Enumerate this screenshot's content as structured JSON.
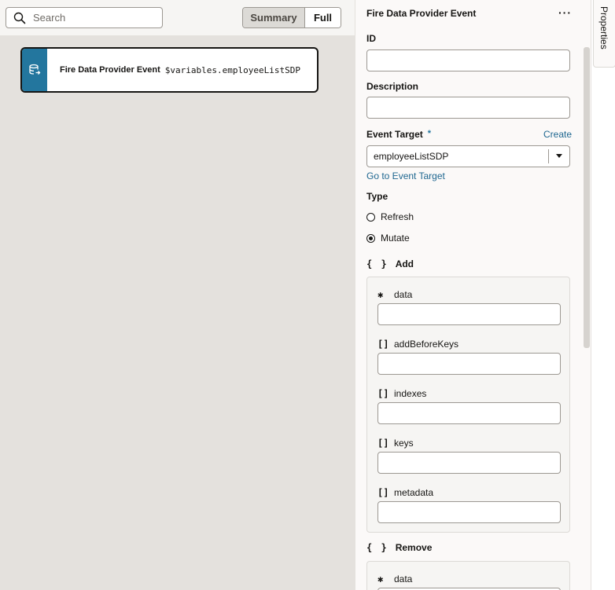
{
  "canvas": {
    "search": {
      "placeholder": "Search"
    },
    "view_toggle": {
      "summary_label": "Summary",
      "full_label": "Full",
      "selected": "Summary"
    },
    "action": {
      "title": "Fire Data Provider Event",
      "expression": "$variables.employeeListSDP",
      "icon": "database-event-icon"
    }
  },
  "panel": {
    "title": "Fire Data Provider Event",
    "more_label": "···",
    "id": {
      "label": "ID",
      "value": ""
    },
    "description": {
      "label": "Description",
      "value": ""
    },
    "event_target": {
      "label": "Event Target",
      "required_marker": "*",
      "create_link": "Create",
      "value": "employeeListSDP",
      "goto_link": "Go to Event Target"
    },
    "type": {
      "label": "Type",
      "options": [
        "Refresh",
        "Mutate"
      ],
      "selected": "Mutate"
    },
    "add": {
      "label": "Add",
      "braces": "{ }",
      "props": [
        {
          "glyph": "✱",
          "label": "data",
          "value": ""
        },
        {
          "glyph": "[]",
          "label": "addBeforeKeys",
          "value": ""
        },
        {
          "glyph": "[]",
          "label": "indexes",
          "value": ""
        },
        {
          "glyph": "[]",
          "label": "keys",
          "value": ""
        },
        {
          "glyph": "[]",
          "label": "metadata",
          "value": ""
        }
      ]
    },
    "remove": {
      "label": "Remove",
      "braces": "{ }",
      "props": [
        {
          "glyph": "✱",
          "label": "data",
          "value": ""
        }
      ]
    }
  },
  "sidetab": {
    "label": "Properties"
  },
  "colors": {
    "accent": "#23769e",
    "link": "#1f6790",
    "canvas_bg": "#e4e1dd"
  }
}
